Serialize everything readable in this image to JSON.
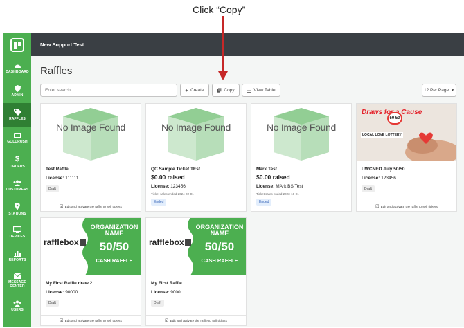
{
  "annotation": {
    "text": "Click “Copy”"
  },
  "app": {
    "title": "New Support Test"
  },
  "sidebar": {
    "items": [
      {
        "label": "DASHBOARD",
        "icon": "gauge-icon"
      },
      {
        "label": "ADMIN",
        "icon": "shield-icon"
      },
      {
        "label": "RAFFLES",
        "icon": "tag-icon",
        "active": true
      },
      {
        "label": "GOLDRUSH",
        "icon": "ticket-icon"
      },
      {
        "label": "ORDERS",
        "icon": "dollar-icon"
      },
      {
        "label": "CUSTOMERS",
        "icon": "users-icon"
      },
      {
        "label": "STATIONS",
        "icon": "map-marker-icon"
      },
      {
        "label": "DEVICES",
        "icon": "monitor-icon"
      },
      {
        "label": "REPORTS",
        "icon": "bar-chart-icon"
      },
      {
        "label": "MESSAGE CENTER",
        "icon": "envelope-icon"
      },
      {
        "label": "USERS",
        "icon": "users-group-icon"
      }
    ]
  },
  "page": {
    "title": "Raffles"
  },
  "toolbar": {
    "search_placeholder": "Enter search",
    "create_label": "Create",
    "copy_label": "Copy",
    "view_table_label": "View Table",
    "per_page_label": "12 Per Page"
  },
  "cards": [
    {
      "image": "No Image Found",
      "title": "Test Raffle",
      "raised": "",
      "license": "111111",
      "note": "",
      "status": "Draft",
      "footer": "Edit and activate the raffle to sell tickets"
    },
    {
      "image": "No Image Found",
      "title": "QC Sample Ticket TEst",
      "raised": "$0.00 raised",
      "license": "123456",
      "note": "Ticket sales ended 2024-02-01",
      "status": "Ended",
      "footer": ""
    },
    {
      "image": "No Image Found",
      "title": "Mark Test",
      "raised": "$0.00 raised",
      "license": "MArk BS Test",
      "note": "Ticket sales ended 2023-10-01",
      "status": "Ended",
      "footer": ""
    },
    {
      "image_title": "Draws for a Cause",
      "image_sub": "LOCAL LOVE LOTTERY",
      "image_badge": "50 50",
      "title": "UWCNEO July 50/50",
      "raised": "",
      "license": "123456",
      "note": "",
      "status": "Draft",
      "footer": "Edit and activate the raffle to sell tickets"
    },
    {
      "image_brand": "rafflebox",
      "image_org": "ORGANIZATION NAME",
      "image_5050": "50/50",
      "image_cash": "CASH RAFFLE",
      "title": "My First Raffle draw 2",
      "raised": "",
      "license": "90000",
      "note": "",
      "status": "Draft",
      "footer": "Edit and activate the raffle to sell tickets"
    },
    {
      "image_brand": "rafflebox",
      "image_org": "ORGANIZATION NAME",
      "image_5050": "50/50",
      "image_cash": "CASH RAFFLE",
      "title": "My First Raffle",
      "raised": "",
      "license": "9000",
      "note": "",
      "status": "Draft",
      "footer": "Edit and activate the raffle to sell tickets"
    }
  ],
  "labels": {
    "license_prefix": "License:"
  },
  "colors": {
    "brand_green": "#4caf50",
    "sidebar_active": "#2f7f33",
    "topbar": "#3a3f44",
    "arrow": "#c62828"
  }
}
